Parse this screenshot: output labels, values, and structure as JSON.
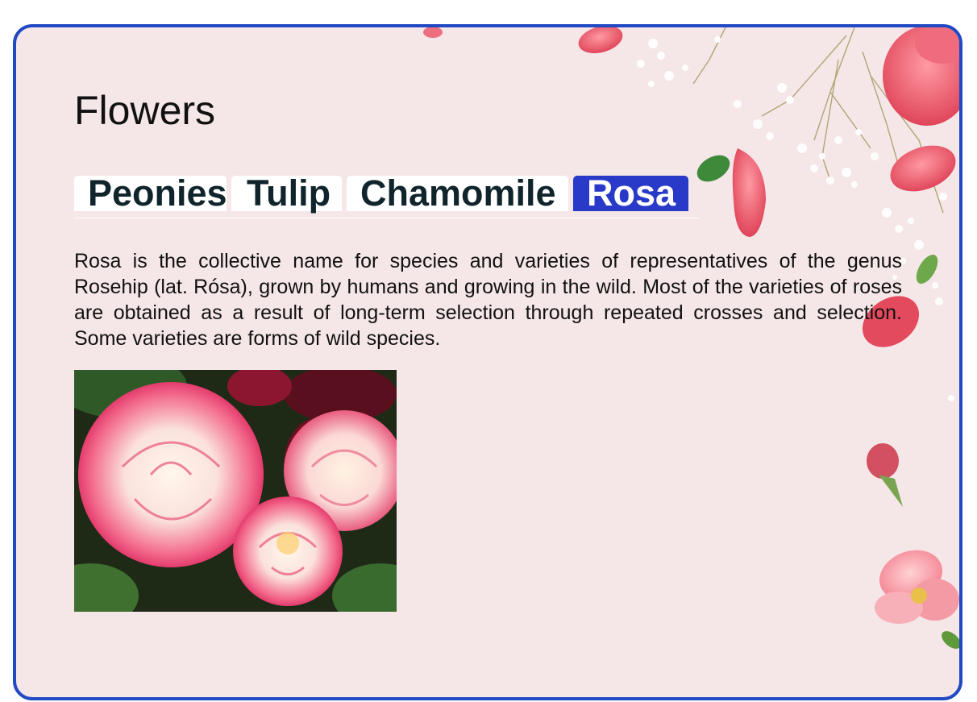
{
  "page": {
    "title": "Flowers"
  },
  "tabs": [
    {
      "label": "Peonies",
      "active": false
    },
    {
      "label": "Tulip",
      "active": false
    },
    {
      "label": "Chamomile",
      "active": false
    },
    {
      "label": "Rosa",
      "active": true
    }
  ],
  "content": {
    "description": "Rosa is the collective name for species and varieties of representatives of the genus Rosehip (lat. Rósa), grown by humans and growing in the wild. Most of the varieties of roses are obtained as a result of long-term selection through repeated crosses and selection. Some varieties are forms of wild species."
  },
  "colors": {
    "border": "#2149c4",
    "active_tab_bg": "#2a3ac8",
    "tab_bg": "#ffffff",
    "tab_text": "#10242b",
    "background": "#f5e6e8"
  }
}
